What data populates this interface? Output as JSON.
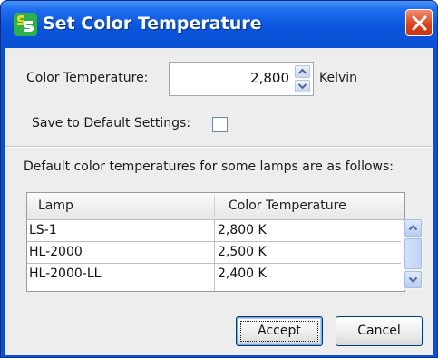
{
  "window": {
    "title": "Set Color Temperature",
    "app_icon": "ss-logo-icon",
    "close_icon": "close-icon"
  },
  "form": {
    "temperature_label": "Color Temperature:",
    "temperature_value": "2,800",
    "temperature_unit": "Kelvin",
    "save_default_label": "Save to Default Settings:",
    "save_default_checked": false
  },
  "info_text": "Default color temperatures for some lamps are as follows:",
  "table": {
    "columns": [
      "Lamp",
      "Color Temperature"
    ],
    "rows": [
      {
        "lamp": "LS-1",
        "temp": "2,800 K"
      },
      {
        "lamp": "HL-2000",
        "temp": "2,500 K"
      },
      {
        "lamp": "HL-2000-LL",
        "temp": "2,400 K"
      }
    ]
  },
  "buttons": {
    "accept": "Accept",
    "cancel": "Cancel"
  },
  "colors": {
    "titlebar": "#0a4fd6",
    "close_button": "#d9421c",
    "dialog_bg": "#ededed"
  }
}
